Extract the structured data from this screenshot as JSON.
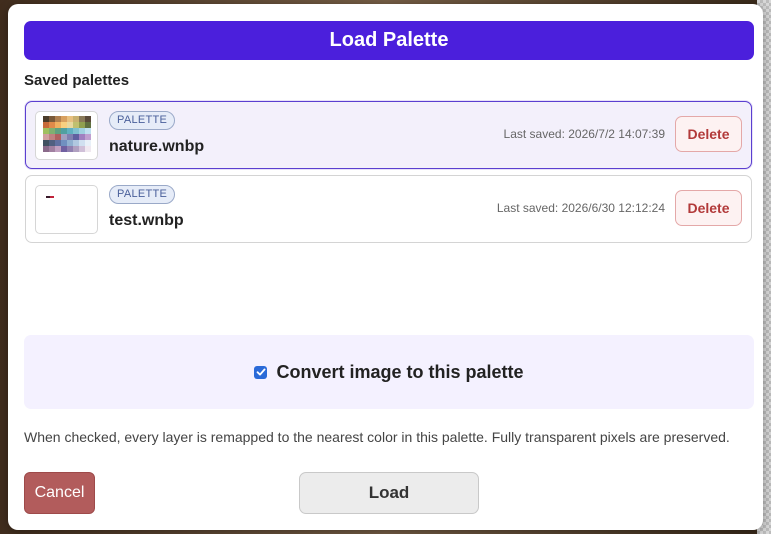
{
  "dialog": {
    "title": "Load Palette",
    "section_label": "Saved palettes",
    "accent_color": "#4b1fdc"
  },
  "palettes": [
    {
      "badge": "PALETTE",
      "name": "nature.wnbp",
      "saved": "Last saved: 2026/7/2 14:07:39",
      "delete_label": "Delete",
      "selected": true
    },
    {
      "badge": "PALETTE",
      "name": "test.wnbp",
      "saved": "Last saved: 2026/6/30 12:12:24",
      "delete_label": "Delete",
      "selected": false
    }
  ],
  "convert": {
    "label": "Convert image to this palette",
    "checked": true
  },
  "help_text": "When checked, every layer is remapped to the nearest color in this palette. Fully transparent pixels are preserved.",
  "buttons": {
    "cancel": "Cancel",
    "load": "Load"
  },
  "icons": {
    "check": "checkmark-icon"
  }
}
